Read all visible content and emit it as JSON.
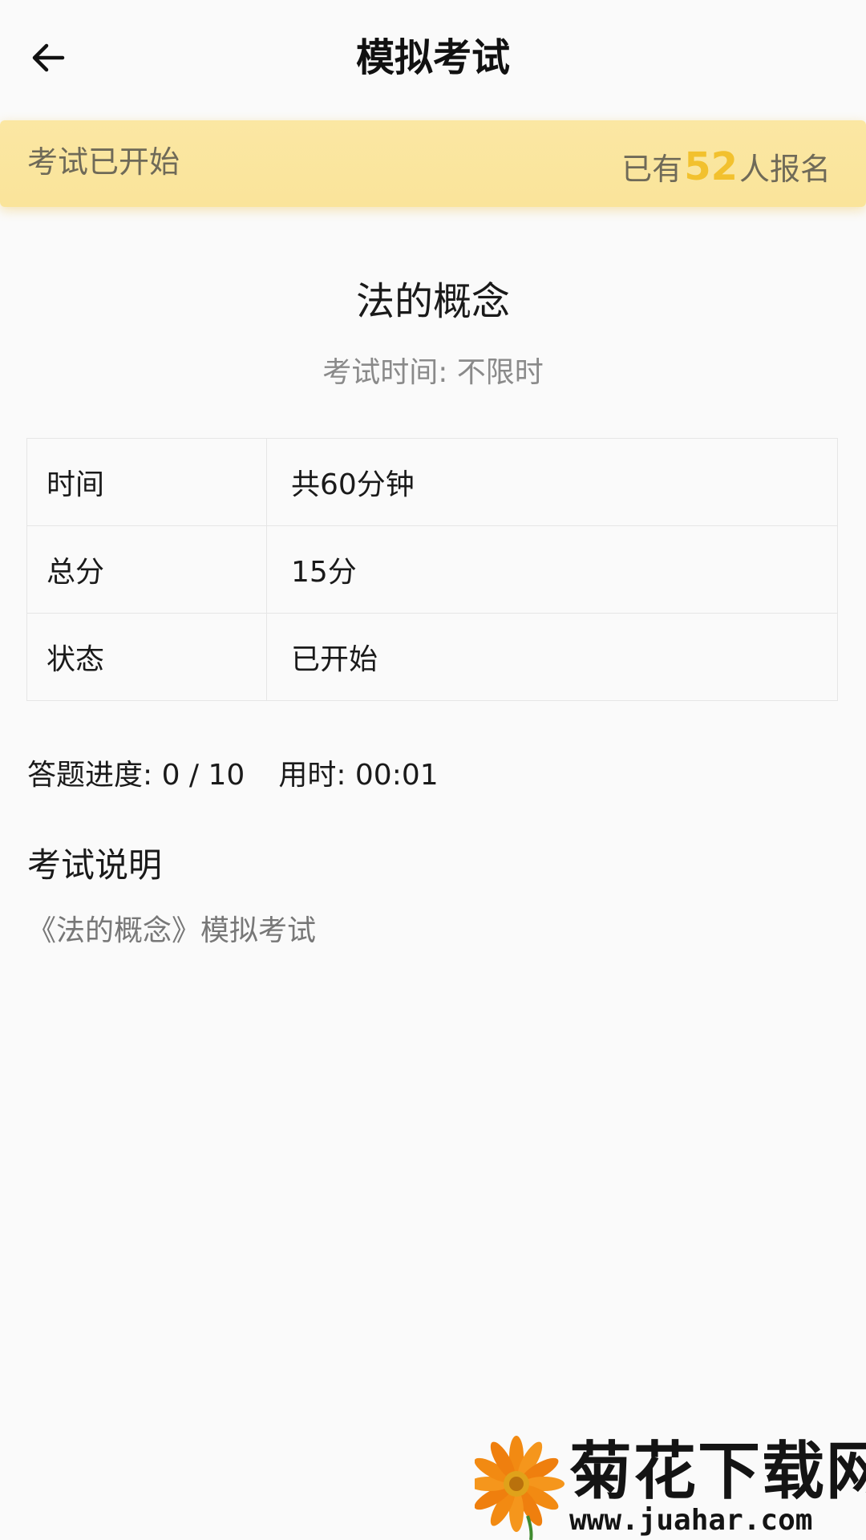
{
  "header": {
    "title": "模拟考试",
    "back_icon": "arrow-left-icon"
  },
  "banner": {
    "status": "考试已开始",
    "count_prefix": "已有",
    "count_value": "52",
    "count_suffix": "人报名",
    "accent_color": "#f2c12e",
    "background_color": "#fae49a"
  },
  "exam": {
    "name": "法的概念",
    "time_text": "考试时间: 不限时"
  },
  "info_table": {
    "rows": [
      {
        "label": "时间",
        "value": "共60分钟"
      },
      {
        "label": "总分",
        "value": "15分"
      },
      {
        "label": "状态",
        "value": "已开始"
      }
    ]
  },
  "progress": {
    "answered_label": "答题进度: 0 / 10",
    "elapsed_label": "用时: 00:01"
  },
  "description": {
    "title": "考试说明",
    "body": "《法的概念》模拟考试"
  },
  "watermark": {
    "brand": "菊花下载网",
    "url": "www.juahar.com",
    "logo_icon": "chrysanthemum-logo-icon"
  }
}
